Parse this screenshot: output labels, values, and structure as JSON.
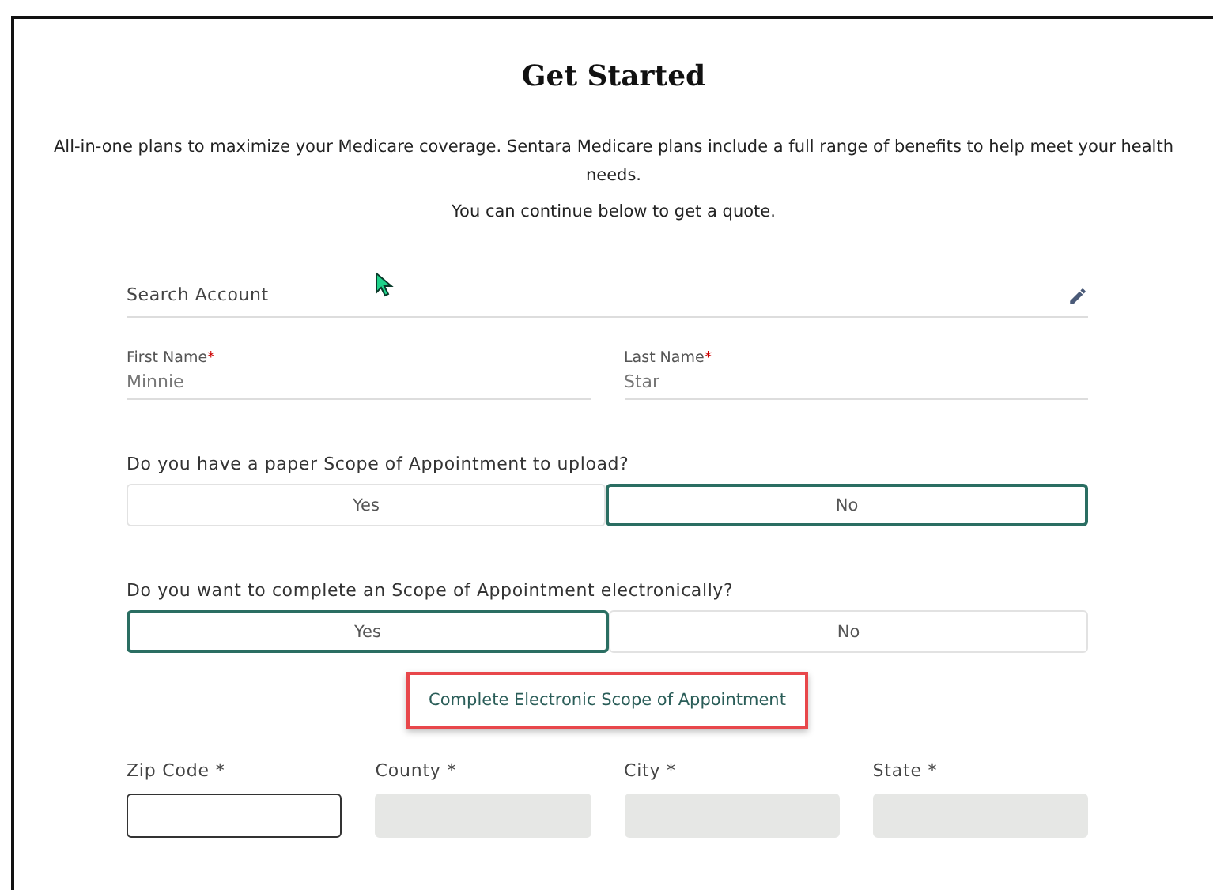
{
  "title": "Get Started",
  "intro": [
    "All-in-one plans to maximize your Medicare coverage. Sentara Medicare plans include a full range of benefits to help meet your health needs.",
    "You can continue below to get a quote."
  ],
  "search_account": {
    "placeholder": "Search Account"
  },
  "name_fields": [
    {
      "label": "First Name",
      "mark": "*",
      "value": "Minnie"
    },
    {
      "label": "Last Name",
      "mark": "*",
      "value": "Star"
    }
  ],
  "questions": [
    {
      "label": "Do you have a paper Scope of Appointment to upload?",
      "options": [
        {
          "label": "Yes",
          "selected": false
        },
        {
          "label": "No",
          "selected": true
        }
      ]
    },
    {
      "label": "Do you want to complete an Scope of Appointment electronically?",
      "options": [
        {
          "label": "Yes",
          "selected": true
        },
        {
          "label": "No",
          "selected": false
        }
      ]
    }
  ],
  "link": {
    "label": "Complete Electronic Scope of Appointment",
    "highlighted": true
  },
  "address_fields": [
    {
      "label": "Zip Code *",
      "disabled": false
    },
    {
      "label": "County *",
      "disabled": true
    },
    {
      "label": "City *",
      "disabled": true
    },
    {
      "label": "State *",
      "disabled": true
    }
  ]
}
